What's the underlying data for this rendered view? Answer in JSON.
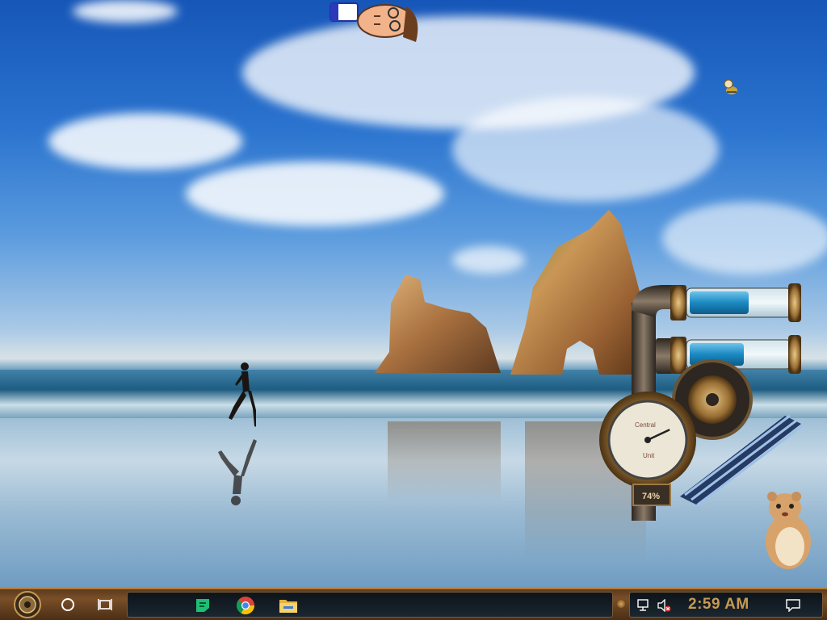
{
  "desktop": {
    "wallpaper": "beach-rocks-runner",
    "accent": "#c79a52"
  },
  "gadget": {
    "gauge_label_top": "Central",
    "gauge_label_bottom": "Unit",
    "gauge_value": "74%",
    "gauge_fraction": 0.74,
    "bar1_fill": 0.6,
    "bar2_fill": 0.55
  },
  "taskbar": {
    "start_icon": "steampunk-gear-start-icon",
    "search_icon": "circle-search-icon",
    "taskview_icon": "task-view-icon",
    "pinned_apps": [
      {
        "name": "green-notes-app",
        "icon": "notes-icon",
        "color": "#1dbf73"
      },
      {
        "name": "chrome",
        "icon": "chrome-icon",
        "color": "#db4437"
      },
      {
        "name": "file-explorer",
        "icon": "folder-icon",
        "color": "#f0c040"
      }
    ],
    "tray": {
      "network_icon": "network-icon",
      "volume_icon": "volume-muted-icon",
      "clock": "2:59 AM",
      "notifications_icon": "action-center-icon"
    }
  }
}
